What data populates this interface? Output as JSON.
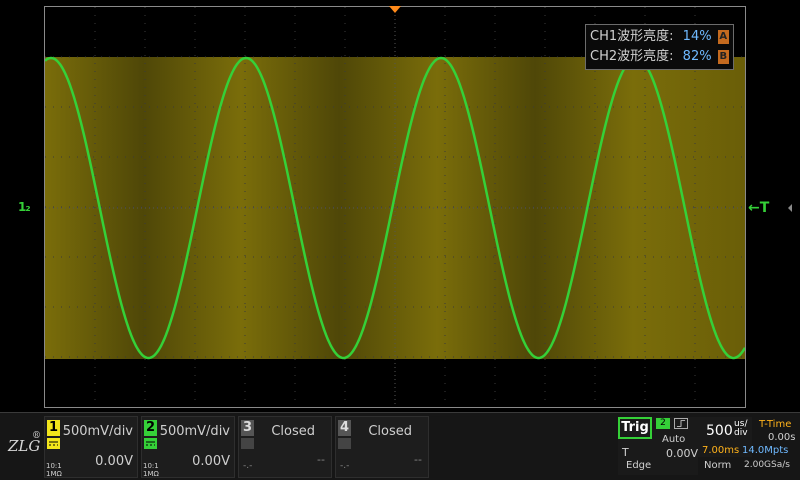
{
  "brightness": {
    "ch1": {
      "label": "CH1波形亮度:",
      "value": "14%",
      "badge": "A"
    },
    "ch2": {
      "label": "CH2波形亮度:",
      "value": "82%",
      "badge": "B"
    }
  },
  "markers": {
    "ch1_offset": "1₂",
    "trigger_level": "←T"
  },
  "channels": [
    {
      "num": "1",
      "scale": "500mV/div",
      "offset": "0.00V",
      "coupling_info": "10:1\n1MΩ",
      "color": "#f2e51b"
    },
    {
      "num": "2",
      "scale": "500mV/div",
      "offset": "0.00V",
      "coupling_info": "10:1\n1MΩ",
      "color": "#35d038"
    },
    {
      "num": "3",
      "status": "Closed",
      "dash1": "-.-",
      "dash2": "--"
    },
    {
      "num": "4",
      "status": "Closed",
      "dash1": "-.-",
      "dash2": "--"
    }
  ],
  "trigger": {
    "label": "Trig",
    "source": "2",
    "mode": "Auto",
    "type_label": "T",
    "level": "0.00V",
    "edge": "Edge"
  },
  "timebase": {
    "value": "500",
    "unit": "us/\ndiv",
    "delay": "7.00ms",
    "memory": "14.0Mpts",
    "acq_mode": "Norm",
    "sample_rate": "2.00GSa/s"
  },
  "ttime": {
    "label": "T-Time",
    "value": "0.00s"
  },
  "logo": "ZLG",
  "colors": {
    "ch1": "#f2e51b",
    "ch2": "#35d038",
    "trigger_marker": "#ff8a1a"
  }
}
